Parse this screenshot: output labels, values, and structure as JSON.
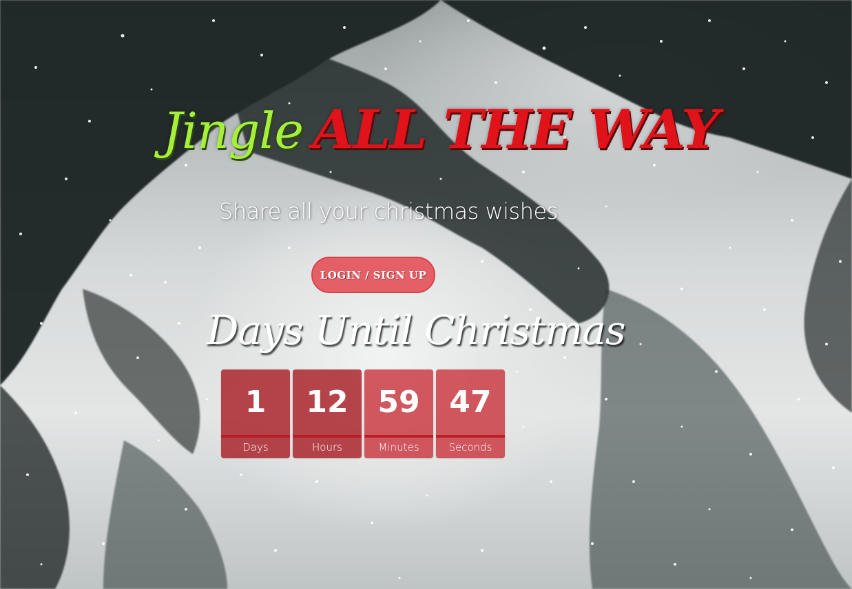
{
  "hero": {
    "title_part1": "Jingle",
    "title_part2": "ALL THE WAY",
    "subtitle": "Share all your christmas wishes",
    "login_label": "LOGIN / SIGN UP"
  },
  "countdown": {
    "heading": "Days Until Christmas",
    "units": [
      {
        "value": "1",
        "label": "Days"
      },
      {
        "value": "12",
        "label": "Hours"
      },
      {
        "value": "59",
        "label": "Minutes"
      },
      {
        "value": "47",
        "label": "Seconds"
      }
    ]
  },
  "colors": {
    "jingle": "#a6f03a",
    "all_the_way": "#e0121a",
    "button": "#e45f66",
    "countdown_box": "#c82d34"
  }
}
